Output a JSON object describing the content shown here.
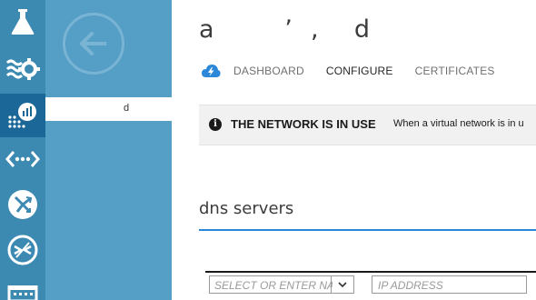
{
  "rail": {
    "items": [
      {
        "icon": "flask-icon",
        "active": false
      },
      {
        "icon": "gears-icon",
        "active": false
      },
      {
        "icon": "analytics-icon",
        "active": true
      },
      {
        "icon": "network-icon",
        "active": false
      },
      {
        "icon": "traffic-manager-icon",
        "active": false
      },
      {
        "icon": "remote-connect-icon",
        "active": false
      },
      {
        "icon": "calendar-icon",
        "active": false
      }
    ]
  },
  "blade": {
    "back_icon": "back-arrow-icon",
    "selected_item": "d"
  },
  "resource_name": "a        ʼ  ,    d",
  "tabs": [
    {
      "label": "DASHBOARD",
      "active": false
    },
    {
      "label": "CONFIGURE",
      "active": true
    },
    {
      "label": "CERTIFICATES",
      "active": false
    }
  ],
  "banner": {
    "icon": "info-icon",
    "title": "THE NETWORK IS IN USE",
    "message": "When a virtual network is in u"
  },
  "dns": {
    "title": "dns servers",
    "name_placeholder": "SELECT OR ENTER NAM",
    "ip_placeholder": "IP ADDRESS"
  },
  "colors": {
    "rail": "#3c89b2",
    "rail_active": "#1b6797",
    "blade": "#559ec6",
    "accent": "#2b88d8"
  }
}
